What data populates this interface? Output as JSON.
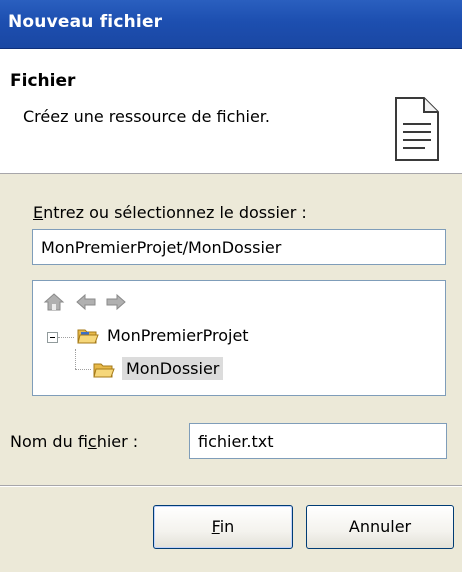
{
  "window": {
    "title": "Nouveau fichier"
  },
  "header": {
    "title": "Fichier",
    "description": "Créez une ressource de fichier.",
    "icon": "file-document-icon"
  },
  "folder": {
    "label_mnemonic": "E",
    "label_rest": "ntrez ou sélectionnez le dossier :",
    "path_value": "MonPremierProjet/MonDossier"
  },
  "tree": {
    "toolbar": {
      "home_icon": "home-icon",
      "back_icon": "back-arrow-icon",
      "forward_icon": "forward-arrow-icon"
    },
    "nodes": [
      {
        "label": "MonPremierProjet",
        "icon": "open-project-folder-icon",
        "expanded": true
      },
      {
        "label": "MonDossier",
        "icon": "open-folder-icon",
        "selected": true
      }
    ]
  },
  "filename": {
    "label_before": "Nom du fi",
    "label_mnemonic": "c",
    "label_after": "hier :",
    "value": "fichier.txt"
  },
  "buttons": {
    "finish_mnemonic": "F",
    "finish_rest": "in",
    "cancel": "Annuler"
  },
  "colors": {
    "titlebar": "#1d4fb0",
    "dialog_background": "#ece9d8",
    "input_border": "#7f9db9"
  }
}
